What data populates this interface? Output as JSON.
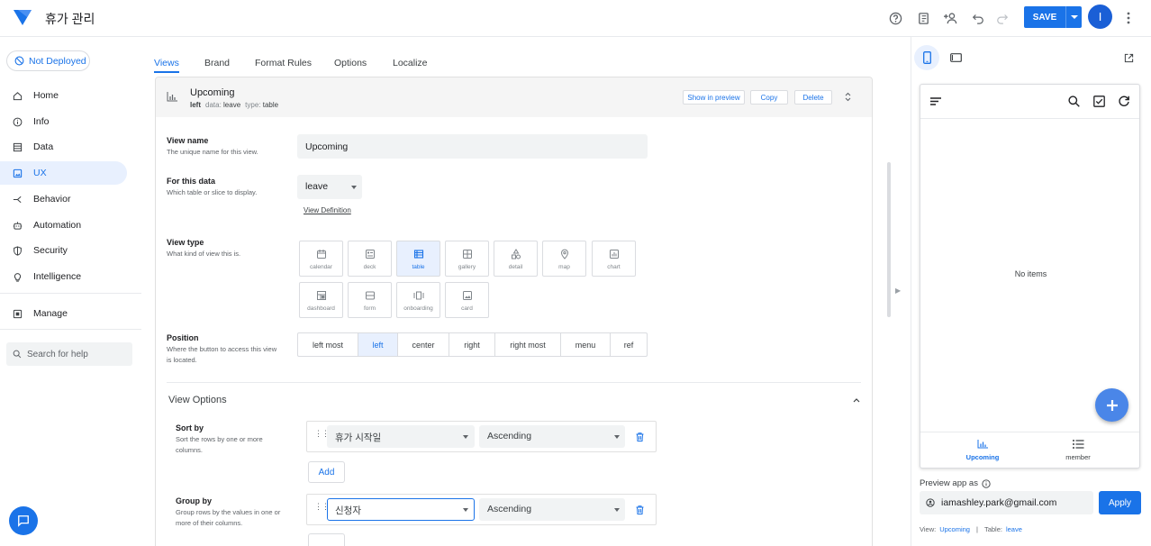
{
  "app": {
    "title": "휴가 관리"
  },
  "topbar": {
    "save_label": "SAVE",
    "avatar_initial": "I"
  },
  "sidebar": {
    "deploy_status": "Not Deployed",
    "items": [
      {
        "label": "Home",
        "icon": "home-icon"
      },
      {
        "label": "Info",
        "icon": "info-icon"
      },
      {
        "label": "Data",
        "icon": "database-icon"
      },
      {
        "label": "UX",
        "icon": "image-icon",
        "active": true
      },
      {
        "label": "Behavior",
        "icon": "behavior-icon"
      },
      {
        "label": "Automation",
        "icon": "robot-icon"
      },
      {
        "label": "Security",
        "icon": "shield-icon"
      },
      {
        "label": "Intelligence",
        "icon": "lightbulb-icon"
      }
    ],
    "manage_label": "Manage",
    "search_placeholder": "Search for help"
  },
  "tabs": [
    "Views",
    "Brand",
    "Format Rules",
    "Options",
    "Localize"
  ],
  "view": {
    "title": "Upcoming",
    "position": "left",
    "data_key": "data:",
    "data_value": "leave",
    "type_key": "type:",
    "type_value": "table",
    "buttons": {
      "show_in_preview": "Show in preview",
      "copy": "Copy",
      "delete": "Delete"
    }
  },
  "form": {
    "view_name": {
      "label": "View name",
      "desc": "The unique name for this view.",
      "value": "Upcoming"
    },
    "for_this_data": {
      "label": "For this data",
      "desc": "Which table or slice to display.",
      "value": "leave",
      "link": "View Definition"
    },
    "view_type": {
      "label": "View type",
      "desc": "What kind of view this is.",
      "options": [
        "calendar",
        "deck",
        "table",
        "gallery",
        "detail",
        "map",
        "chart",
        "dashboard",
        "form",
        "onboarding",
        "card"
      ],
      "selected": "table"
    },
    "position": {
      "label": "Position",
      "desc": "Where the button to access this view is located.",
      "options": [
        "left most",
        "left",
        "center",
        "right",
        "right most",
        "menu",
        "ref"
      ],
      "selected": "left"
    }
  },
  "view_options": {
    "title": "View Options",
    "sort_by": {
      "label": "Sort by",
      "desc": "Sort the rows by one or more columns.",
      "column": "휴가 시작일",
      "order": "Ascending",
      "add_label": "Add"
    },
    "group_by": {
      "label": "Group by",
      "desc": "Group rows by the values in one or more of their columns.",
      "column": "신청자",
      "order": "Ascending"
    }
  },
  "preview": {
    "empty_text": "No items",
    "nav": [
      {
        "label": "Upcoming",
        "active": true
      },
      {
        "label": "member"
      }
    ],
    "preview_as_label": "Preview app as",
    "email": "iamashley.park@gmail.com",
    "apply_label": "Apply",
    "footer": {
      "view_label": "View:",
      "view_value": "Upcoming",
      "sep": "|",
      "table_label": "Table:",
      "table_value": "leave"
    }
  },
  "colors": {
    "accent": "#1a73e8",
    "active_bg": "#e8f0fe"
  }
}
